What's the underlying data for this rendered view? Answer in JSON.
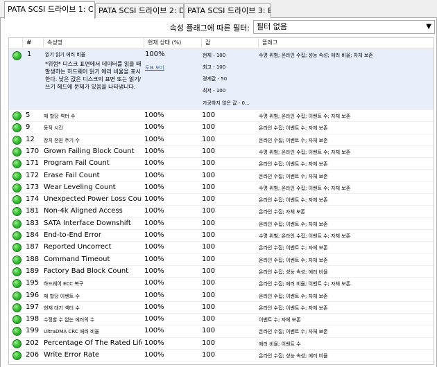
{
  "tabs": [
    {
      "label": "PATA SCSI 드라이브 1: C"
    },
    {
      "label": "PATA SCSI 드라이브 2: D"
    },
    {
      "label": "PATA SCSI 드라이브 3: E"
    }
  ],
  "filter": {
    "label": "속성 플래그에 따른 필터:",
    "value": "필터 없음"
  },
  "columns": {
    "num": "#",
    "attr": "속성명",
    "health": "현재 상태 (%)",
    "value": "값",
    "flags": "플래그"
  },
  "first_row": {
    "num": "1",
    "attr": "읽기 읽기 에러 비율",
    "desc": "*위험* 디스크 표면에서 데이터를 읽을 때 발생하는 하드웨어 읽기 에러 비율을 표시한다. 낮은 값은 디스크의 표면 또는 읽기/쓰기 헤드에 문제가 있음을 나타냅니다.",
    "health": "100%",
    "link": "도표 보기",
    "values": [
      "현재 - 100",
      "최고 - 100",
      "경계값 - 50",
      "최저 - 100",
      "가공하지 않은 값 - 0..."
    ],
    "flags": "수명 위험; 온라인 수집; 성능 속성; 에러 비율; 자체 보존"
  },
  "rows": [
    {
      "num": "5",
      "attr": "재 할당 섹터 수",
      "health": "100%",
      "value": "100",
      "flags": "수명 위험; 온라인 수집; 이벤트 수; 자체 보존"
    },
    {
      "num": "9",
      "attr": "동작 시간",
      "health": "100%",
      "value": "100",
      "flags": "온라인 수집; 이벤트 수; 자체 보존"
    },
    {
      "num": "12",
      "attr": "장치 전원 주기 수",
      "health": "100%",
      "value": "100",
      "flags": "온라인 수집; 이벤트 수; 자체 보존"
    },
    {
      "num": "170",
      "attr": "Grown Failing Block Count",
      "health": "100%",
      "value": "100",
      "flags": "수명 위험; 온라인 수집; 이벤트 수; 자체 보존"
    },
    {
      "num": "171",
      "attr": "Program Fail Count",
      "health": "100%",
      "value": "100",
      "flags": "온라인 수집; 이벤트 수; 자체 보존"
    },
    {
      "num": "172",
      "attr": "Erase Fail Count",
      "health": "100%",
      "value": "100",
      "flags": "온라인 수집; 이벤트 수; 자체 보존"
    },
    {
      "num": "173",
      "attr": "Wear Leveling Count",
      "health": "100%",
      "value": "100",
      "flags": "수명 위험; 온라인 수집; 이벤트 수; 자체 보존"
    },
    {
      "num": "174",
      "attr": "Unexpected Power Loss Count",
      "health": "100%",
      "value": "100",
      "flags": "온라인 수집; 이벤트 수; 자체 보존"
    },
    {
      "num": "181",
      "attr": "Non-4k Aligned Access",
      "health": "100%",
      "value": "100",
      "flags": "온라인 수집; 자체 보존"
    },
    {
      "num": "183",
      "attr": "SATA Interface Downshift",
      "health": "100%",
      "value": "100",
      "flags": "온라인 수집; 이벤트 수; 자체 보존"
    },
    {
      "num": "184",
      "attr": "End-to-End Error",
      "health": "100%",
      "value": "100",
      "flags": "수명 위험; 온라인 수집; 이벤트 수; 자체 보존"
    },
    {
      "num": "187",
      "attr": "Reported Uncorrect",
      "health": "100%",
      "value": "100",
      "flags": "온라인 수집; 이벤트 수; 자체 보존"
    },
    {
      "num": "188",
      "attr": "Command Timeout",
      "health": "100%",
      "value": "100",
      "flags": "온라인 수집; 이벤트 수; 자체 보존"
    },
    {
      "num": "189",
      "attr": "Factory Bad Block Count",
      "health": "100%",
      "value": "100",
      "flags": "온라인 수집; 성능 속성; 에러 비율"
    },
    {
      "num": "195",
      "attr": "하드웨어 ECC 복구",
      "health": "100%",
      "value": "100",
      "flags": "온라인 수집; 에러 비율; 이벤트 수; 자체 보존"
    },
    {
      "num": "196",
      "attr": "재 할당 이벤트 수",
      "health": "100%",
      "value": "100",
      "flags": "온라인 수집; 이벤트 수; 자체 보존"
    },
    {
      "num": "197",
      "attr": "현재 대기 섹터 수",
      "health": "100%",
      "value": "100",
      "flags": "온라인 수집; 이벤트 수; 자체 보존"
    },
    {
      "num": "198",
      "attr": "수정할 수 없는 에러의 수",
      "health": "100%",
      "value": "100",
      "flags": "이벤트 수; 자체 보존"
    },
    {
      "num": "199",
      "attr": "UltraDMA CRC 에러 비율",
      "health": "100%",
      "value": "100",
      "flags": "온라인 수집; 이벤트 수; 자체 보존"
    },
    {
      "num": "202",
      "attr": "Percentage Of The Rated Lifeti...",
      "health": "100%",
      "value": "100",
      "flags": "에러 비율; 이벤트 수"
    },
    {
      "num": "206",
      "attr": "Write Error Rate",
      "health": "100%",
      "value": "100",
      "flags": "온라인 수집; 성능 속성; 에러 비율"
    }
  ],
  "status_color": "#3cc43a"
}
